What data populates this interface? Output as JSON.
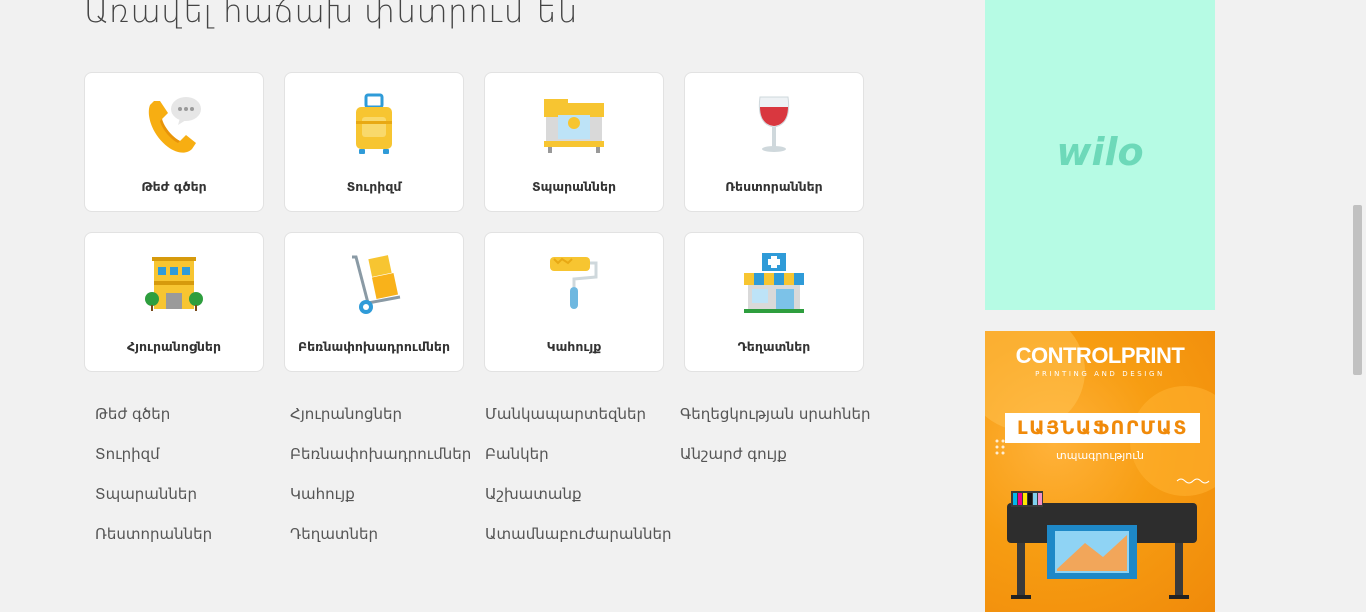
{
  "heading": "Առավել հաճախ փնտրում են",
  "cards": [
    {
      "label": "Թեժ գծեր",
      "icon": "phone-icon"
    },
    {
      "label": "Տուրիզմ",
      "icon": "suitcase-icon"
    },
    {
      "label": "Տպարաններ",
      "icon": "printer-icon"
    },
    {
      "label": "Ռեստորաններ",
      "icon": "wine-glass-icon"
    },
    {
      "label": "Հյուրանոցներ",
      "icon": "hotel-icon"
    },
    {
      "label": "Բեռնափոխադրումներ",
      "icon": "hand-truck-icon"
    },
    {
      "label": "Կահույք",
      "icon": "paint-roller-icon"
    },
    {
      "label": "Դեղատներ",
      "icon": "pharmacy-icon"
    }
  ],
  "links": {
    "col1": [
      "Թեժ գծեր",
      "Տուրիզմ",
      "Տպարաններ",
      "Ռեստորաններ"
    ],
    "col2": [
      "Հյուրանոցներ",
      "Բեռնափոխադրումներ",
      "Կահույք",
      "Դեղատներ"
    ],
    "col3": [
      "Մանկապարտեզներ",
      "Բանկեր",
      "Աշխատանք",
      "Ատամնաբուժարաններ"
    ],
    "col4": [
      "Գեղեցկության սրահներ",
      "Անշարժ գույք"
    ]
  },
  "ads": {
    "wilo": {
      "logo": "wilo",
      "bg": "#b6fbe4",
      "color": "#6dd9b9"
    },
    "controlprint": {
      "brand_a": "CONTROL",
      "brand_b": "PRINT",
      "tagline": "PRINTING AND DESIGN",
      "headline": "ԼԱՅՆԱՖՈՐՄԱՏ",
      "subline": "տպագրություն"
    }
  }
}
